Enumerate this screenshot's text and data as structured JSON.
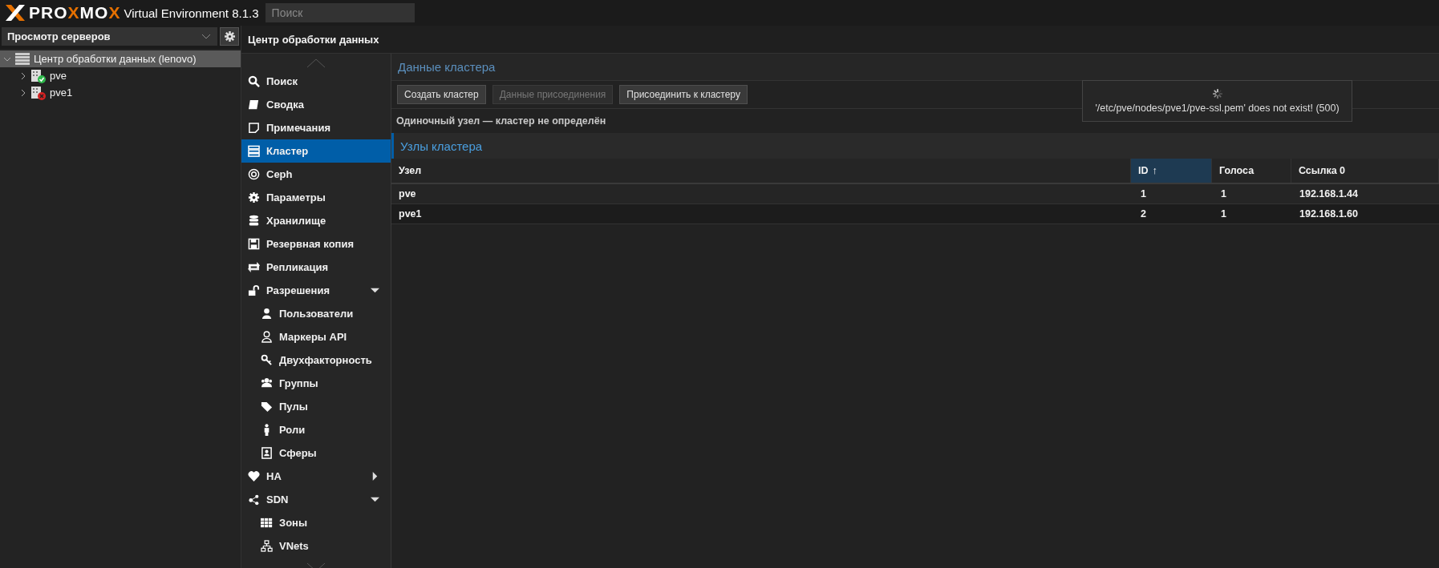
{
  "header": {
    "logo": "PROXMOX",
    "product": "Virtual Environment 8.1.3",
    "search": {
      "placeholder": "Поиск"
    }
  },
  "sidebar": {
    "view_selector": "Просмотр серверов",
    "tree": [
      {
        "label": "Центр обработки данных (lenovo)",
        "selected": true,
        "expanded": true,
        "children": [
          {
            "label": "pve",
            "selected": false,
            "expanded": false,
            "online": true
          },
          {
            "label": "pve1",
            "selected": false,
            "expanded": false,
            "online": false
          }
        ]
      }
    ]
  },
  "content_title": "Центр обработки данных",
  "nav": [
    {
      "label": "Поиск",
      "selected": false
    },
    {
      "label": "Сводка",
      "selected": false
    },
    {
      "label": "Примечания",
      "selected": false
    },
    {
      "label": "Кластер",
      "selected": true
    },
    {
      "label": "Ceph",
      "selected": false
    },
    {
      "label": "Параметры",
      "selected": false
    },
    {
      "label": "Хранилище",
      "selected": false
    },
    {
      "label": "Резервная копия",
      "selected": false
    },
    {
      "label": "Репликация",
      "selected": false
    },
    {
      "label": "Разрешения",
      "selected": false,
      "expanded": true,
      "children": [
        {
          "label": "Пользователи",
          "selected": false
        },
        {
          "label": "Маркеры API",
          "selected": false
        },
        {
          "label": "Двухфакторность",
          "selected": false
        },
        {
          "label": "Группы",
          "selected": false
        },
        {
          "label": "Пулы",
          "selected": false
        },
        {
          "label": "Роли",
          "selected": false
        },
        {
          "label": "Сферы",
          "selected": false
        }
      ]
    },
    {
      "label": "HA",
      "selected": false,
      "expanded": false
    },
    {
      "label": "SDN",
      "selected": false,
      "expanded": true,
      "children": [
        {
          "label": "Зоны",
          "selected": false
        },
        {
          "label": "VNets",
          "selected": false
        }
      ]
    }
  ],
  "cluster_panel": {
    "title": "Данные кластера",
    "buttons": [
      {
        "label": "Создать кластер",
        "disabled": false
      },
      {
        "label": "Данные присоединения",
        "disabled": true
      },
      {
        "label": "Присоединить к кластеру",
        "disabled": false
      }
    ],
    "status": "Одиночный узел — кластер не определён"
  },
  "toast": {
    "message": "'/etc/pve/nodes/pve1/pve-ssl.pem' does not exist! (500)"
  },
  "nodes_panel": {
    "title": "Узлы кластера",
    "columns": [
      {
        "label": "Узел",
        "sorted": false
      },
      {
        "label": "ID",
        "sorted": true
      },
      {
        "label": "Голоса",
        "sorted": false
      },
      {
        "label": "Ссылка 0",
        "sorted": false
      }
    ],
    "sort_arrow": "↑",
    "rows": [
      [
        "pve",
        "1",
        "1",
        "192.168.1.44"
      ],
      [
        "pve1",
        "2",
        "1",
        "192.168.1.60"
      ]
    ]
  }
}
